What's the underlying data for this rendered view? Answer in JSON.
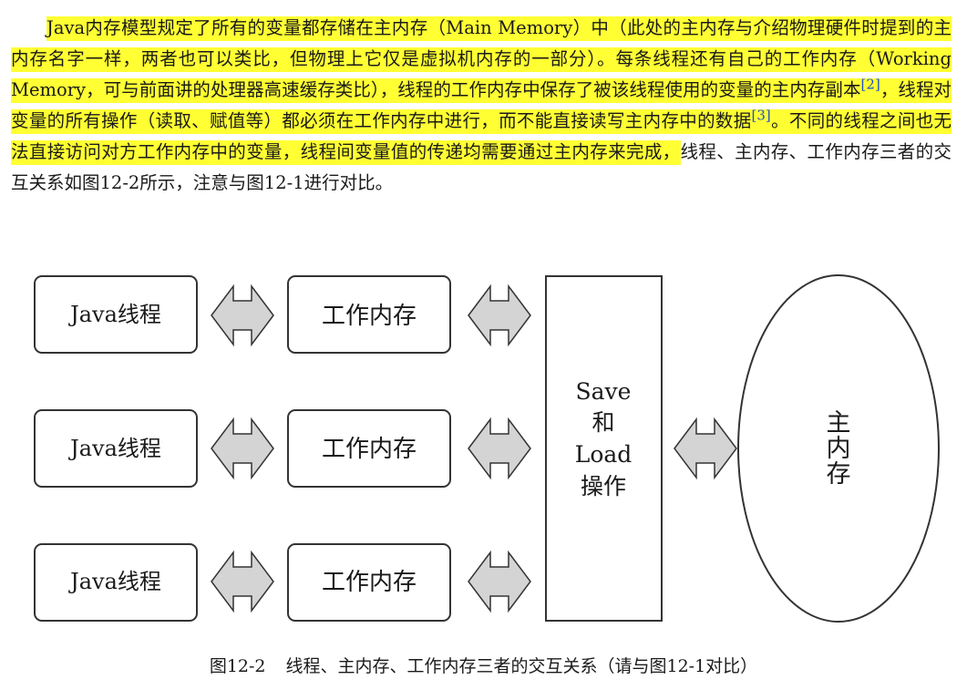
{
  "paragraph": {
    "hl1": "Java内存模型规定了所有的变量都存储在主内存（Main Memory）中（此处的主内存与介绍物理硬件时提到的主内存名字一样，两者也可以类比，但物理上它仅是虚拟机内存的一部分）。",
    "hl2a": "每条线程还有自己的工作内存（Working Memory，可与前面讲的处理器高速缓存类比），线程的工作内存中保存了被该线程使用的变量的主内存副本",
    "ref1": "[2]",
    "hl2b": "，线程对变量的所有操作（读取、赋值等）都必须在工作内存中进行，而不能直接读写主内存中的数据",
    "ref2": "[3]",
    "hl2c": "。",
    "hl3": "不同的线程之间也无法直接访问对方工作内存中的变量，线程间变量值的传递均需要通过主内存来完成，",
    "plain": "线程、主内存、工作内存三者的交互关系如图12-2所示，注意与图12-1进行对比。"
  },
  "diagram": {
    "threads": [
      "Java线程",
      "Java线程",
      "Java线程"
    ],
    "working_memories": [
      "工作内存",
      "工作内存",
      "工作内存"
    ],
    "save_load_lines": [
      "Save",
      "和",
      "Load",
      "操作"
    ],
    "main_memory_lines": [
      "主",
      "内",
      "存"
    ]
  },
  "caption": {
    "number": "图12-2",
    "text": "线程、主内存、工作内存三者的交互关系（请与图12-1对比）"
  },
  "colors": {
    "highlight": "#ffff33",
    "arrow_fill": "#d4d4d4",
    "stroke": "#333333",
    "ref_link": "#1e50c8"
  }
}
